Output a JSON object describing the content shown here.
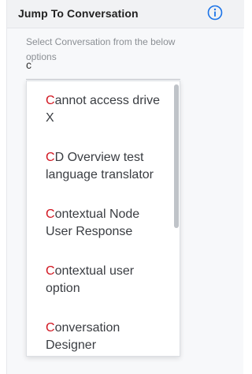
{
  "header": {
    "title": "Jump To Conversation",
    "info_icon": "info-circle-icon",
    "accent_color": "#1a73e8"
  },
  "search": {
    "hint": "Select Conversation from the below options",
    "value": "c"
  },
  "highlight_color": "#d1141f",
  "options": [
    {
      "match": "C",
      "rest": "annot access drive X"
    },
    {
      "match": "C",
      "rest": "D Overview test language translator"
    },
    {
      "match": "C",
      "rest": "ontextual Node User Response"
    },
    {
      "match": "C",
      "rest": "ontextual user option"
    },
    {
      "match": "C",
      "rest": "onversation Designer"
    }
  ]
}
